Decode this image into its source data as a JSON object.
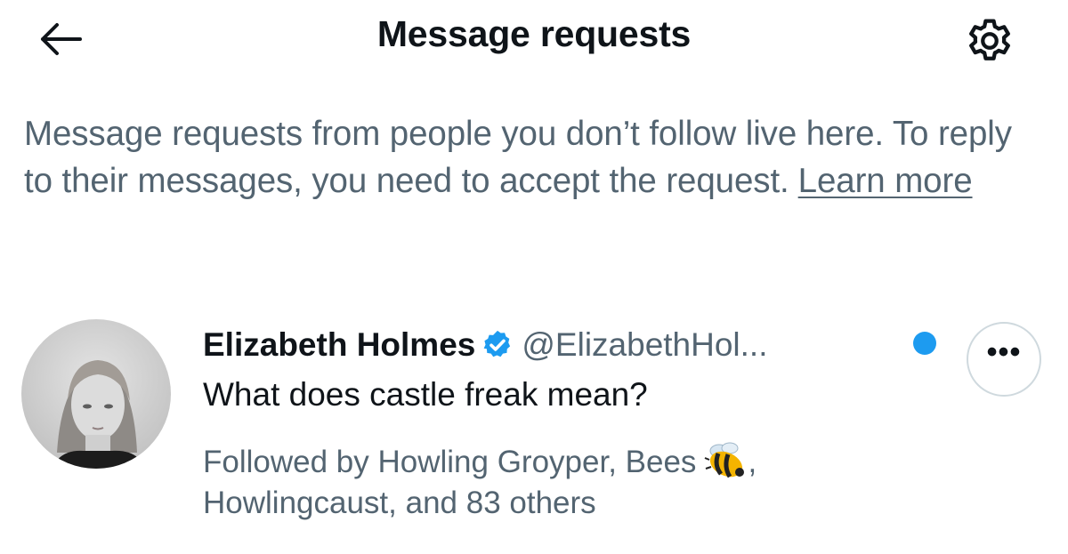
{
  "header": {
    "back_icon": "arrow-left-icon",
    "title": "Message requests",
    "settings_icon": "gear-icon"
  },
  "info": {
    "text": "Message requests from people you don’t follow live here. To reply to their messages, you need to accept the request.",
    "learn_more": "Learn more"
  },
  "request": {
    "display_name": "Elizabeth Holmes",
    "verified_icon": "verified-badge-icon",
    "handle": "@ElizabethHol...",
    "message": "What does castle freak mean?",
    "followed_by_prefix": "Followed by Howling Groyper, Bees",
    "followed_by_suffix": ", Howlingcaust, and 83 others",
    "emoji": "bee-emoji-icon",
    "more_label": "•••",
    "unread": true
  },
  "colors": {
    "text_primary": "#0f1419",
    "text_secondary": "#536471",
    "accent_blue": "#1d9bf0",
    "border": "#cfd9de"
  }
}
